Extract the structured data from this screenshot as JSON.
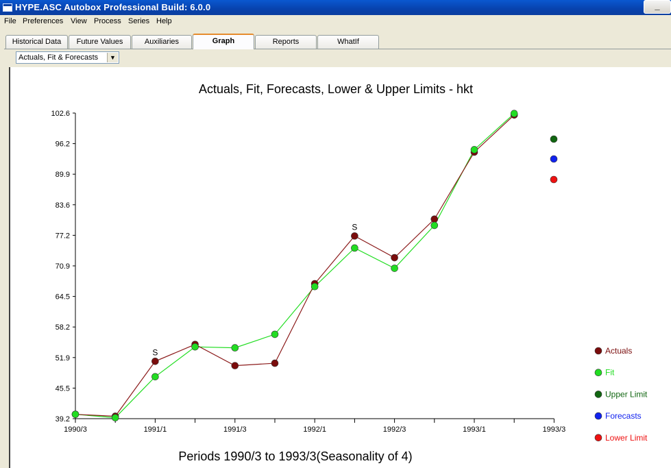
{
  "window": {
    "title": "HYPE.ASC  Autobox Professional Build: 6.0.0",
    "minimize": "_"
  },
  "menu": [
    "File",
    "Preferences",
    "View",
    "Process",
    "Series",
    "Help"
  ],
  "tabs": [
    {
      "label": "Historical Data",
      "active": false
    },
    {
      "label": "Future Values",
      "active": false
    },
    {
      "label": "Auxiliaries",
      "active": false
    },
    {
      "label": "Graph",
      "active": true
    },
    {
      "label": "Reports",
      "active": false
    },
    {
      "label": "WhatIf",
      "active": false
    }
  ],
  "view_select": {
    "value": "Actuals, Fit & Forecasts"
  },
  "chart_data": {
    "type": "line",
    "title": "Actuals, Fit, Forecasts, Lower & Upper Limits - hkt",
    "xlabel": "Periods 1990/3 to 1993/3(Seasonality of 4)",
    "ylabel": "",
    "ylim": [
      39.2,
      102.6
    ],
    "y_ticks": [
      "102.6",
      "96.2",
      "89.9",
      "83.6",
      "77.2",
      "70.9",
      "64.5",
      "58.2",
      "51.9",
      "45.5",
      "39.2"
    ],
    "x_tick_labels": [
      "1990/3",
      "1991/1",
      "1991/3",
      "1992/1",
      "1992/3",
      "1993/1",
      "1993/3"
    ],
    "periods": [
      "1990/3",
      "1990/4",
      "1991/1",
      "1991/2",
      "1991/3",
      "1991/4",
      "1992/1",
      "1992/2",
      "1992/3",
      "1992/4",
      "1993/1",
      "1993/2",
      "1993/3"
    ],
    "series": [
      {
        "name": "Actuals",
        "color": "#7a0c0c",
        "line_color": "#8b1a1a",
        "values": [
          40.1,
          39.7,
          51.1,
          54.6,
          50.2,
          50.7,
          67.2,
          77.1,
          72.6,
          80.6,
          94.5,
          102.2
        ]
      },
      {
        "name": "Fit",
        "color": "#22dd22",
        "line_color": "#22dd22",
        "values": [
          40.1,
          39.4,
          47.9,
          54.1,
          53.9,
          56.7,
          66.6,
          74.6,
          70.4,
          79.3,
          95.0,
          102.5
        ]
      },
      {
        "name": "Upper Limit",
        "color": "#116611",
        "values": []
      },
      {
        "name": "Forecasts",
        "color": "#1122ee",
        "values": []
      },
      {
        "name": "Lower Limit",
        "color": "#ee1111",
        "values": []
      }
    ],
    "annotations": [
      {
        "text": "S",
        "period": "1991/1",
        "value": 51.1
      },
      {
        "text": "S",
        "period": "1992/2",
        "value": 77.1
      }
    ],
    "grid": false,
    "legend_position": "right"
  }
}
